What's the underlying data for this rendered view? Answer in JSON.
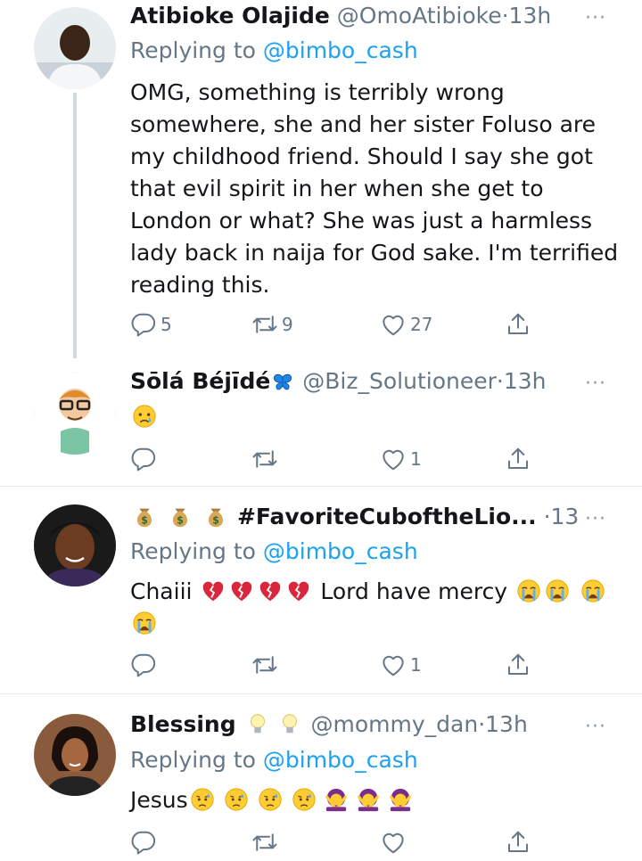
{
  "tweets": [
    {
      "name": "Atibioke Olajide",
      "handle": "@OmoAtibioke",
      "time": "13h",
      "dot": "·",
      "replying_prefix": "Replying to ",
      "replying_handle": "@bimbo_cash",
      "text": "OMG, something is terribly wrong somewhere, she and her sister Foluso are my childhood friend. Should I say she got that evil spirit in her when she get to London or what? She was just a harmless lady back in naija for God sake. I'm terrified reading this.",
      "reply_count": "5",
      "retweet_count": "9",
      "like_count": "27"
    },
    {
      "name": "Sōlá Béjīdé",
      "name_emoji": "butterfly",
      "handle": "@Biz_Solutioneer",
      "time": "13h",
      "dot": "·",
      "text_emoji": "crying-face",
      "reply_count": "",
      "retweet_count": "",
      "like_count": "1"
    },
    {
      "name": "#FavoriteCuboftheLio...",
      "name_emoji": "money-bag x3",
      "handle": "",
      "time": "13h",
      "dot": "·",
      "replying_prefix": "Replying to ",
      "replying_handle": "@bimbo_cash",
      "text_start": "Chaiii",
      "text_end": "Lord have mercy",
      "text_emoji": "broken-heart x4, loudly-crying-face x4",
      "reply_count": "",
      "retweet_count": "",
      "like_count": "1"
    },
    {
      "name": "Blessing",
      "name_emoji": "light-bulb x2",
      "handle": "@mommy_dan",
      "time": "13h",
      "dot": "·",
      "replying_prefix": "Replying to ",
      "replying_handle": "@bimbo_cash",
      "text_start": "Jesus",
      "text_emoji": "sad-relieved-face x4, person-gesturing-no x3",
      "reply_count": "",
      "retweet_count": "",
      "like_count": ""
    }
  ],
  "more_label": "···",
  "colors": {
    "text": "#14171a",
    "secondary": "#657786",
    "link": "#1da1f2",
    "divider": "#e6ecf0",
    "thread_line": "#cfd9de"
  }
}
